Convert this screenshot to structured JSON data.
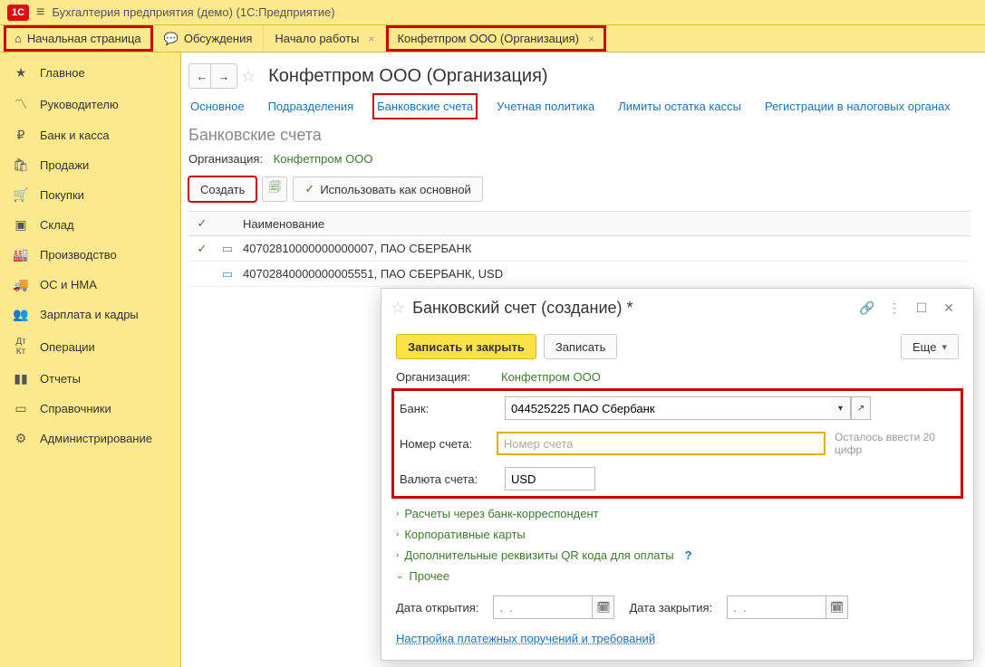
{
  "topbar": {
    "app_title": "Бухгалтерия предприятия (демо)  (1С:Предприятие)"
  },
  "tabs": [
    {
      "label": "Начальная страница",
      "closeable": false
    },
    {
      "label": "Обсуждения",
      "closeable": false
    },
    {
      "label": "Начало работы",
      "closeable": true
    },
    {
      "label": "Конфетпром ООО (Организация)",
      "closeable": true
    }
  ],
  "sidebar": [
    "Главное",
    "Руководителю",
    "Банк и касса",
    "Продажи",
    "Покупки",
    "Склад",
    "Производство",
    "ОС и НМА",
    "Зарплата и кадры",
    "Операции",
    "Отчеты",
    "Справочники",
    "Администрирование"
  ],
  "page": {
    "title": "Конфетпром ООО (Организация)",
    "subtabs": [
      "Основное",
      "Подразделения",
      "Банковские счета",
      "Учетная политика",
      "Лимиты остатка кассы",
      "Регистрации в налоговых органах"
    ],
    "section_title": "Банковские счета",
    "org_label": "Организация:",
    "org_value": "Конфетпром ООО",
    "toolbar": {
      "create": "Создать",
      "use_main": " Использовать как основной"
    },
    "grid": {
      "header": "Наименование",
      "rows": [
        {
          "checked": true,
          "text": "40702810000000000007, ПАО СБЕРБАНК"
        },
        {
          "checked": false,
          "text": "40702840000000005551, ПАО СБЕРБАНК, USD"
        }
      ]
    }
  },
  "modal": {
    "title": "Банковский счет (создание) *",
    "save_close": "Записать и закрыть",
    "save": "Записать",
    "more": "Еще",
    "org_label": "Организация:",
    "org_value": "Конфетпром ООО",
    "bank_label": "Банк:",
    "bank_value": "044525225 ПАО Сбербанк",
    "number_label": "Номер счета:",
    "number_placeholder": "Номер счета",
    "number_hint": "Осталось ввести 20 цифр",
    "currency_label": "Валюта счета:",
    "currency_value": "USD",
    "expand": {
      "a": "Расчеты через банк-корреспондент",
      "b": "Корпоративные карты",
      "c": "Дополнительные реквизиты QR кода для оплаты",
      "d": "Прочее"
    },
    "date_open_label": "Дата открытия:",
    "date_close_label": "Дата закрытия:",
    "date_placeholder": ".  .",
    "link": "Настройка платежных поручений и требований"
  }
}
